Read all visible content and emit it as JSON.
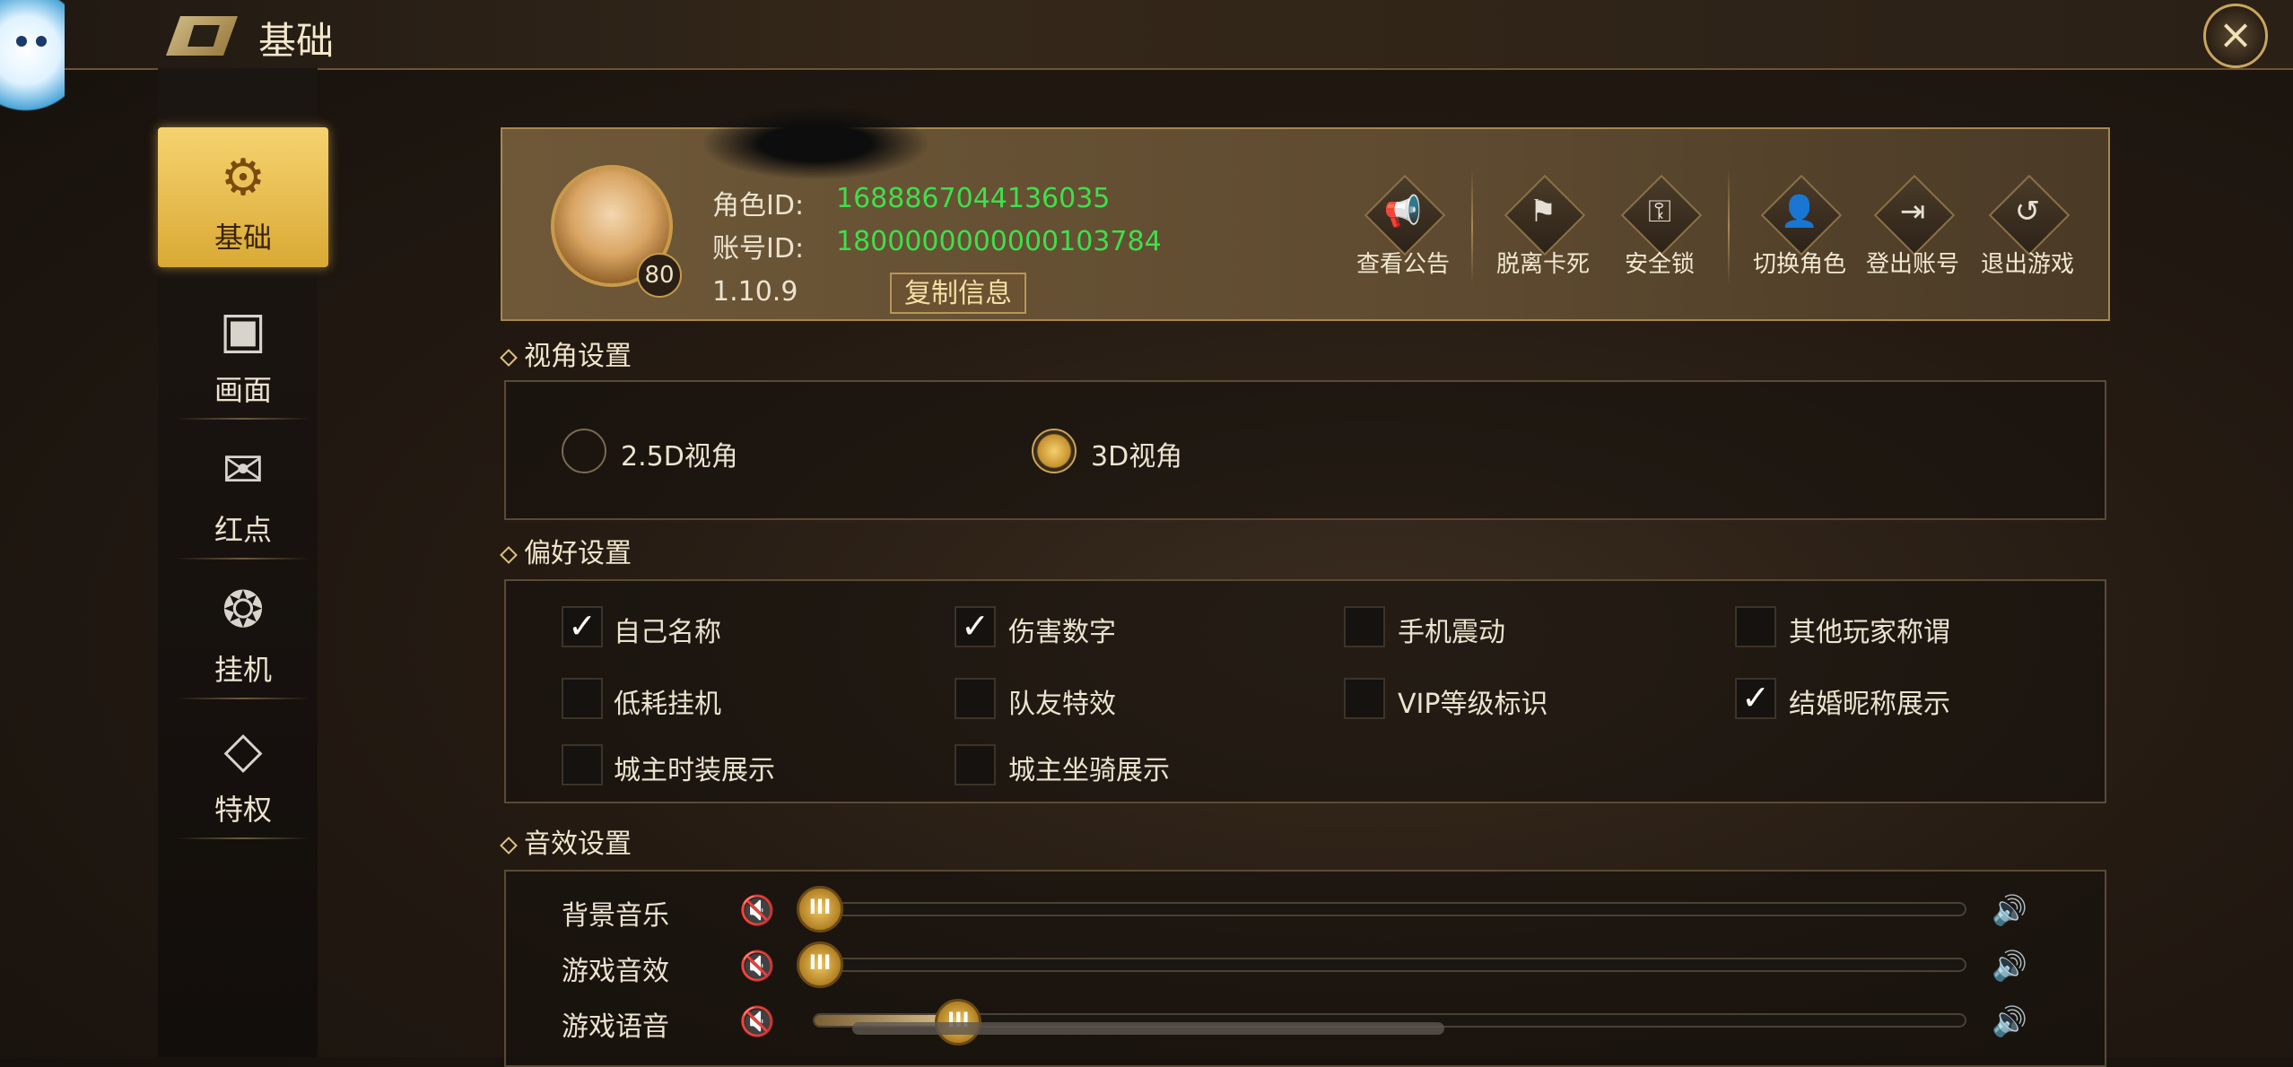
{
  "header": {
    "title": "基础",
    "close_icon": "close-icon"
  },
  "sidebar": {
    "items": [
      {
        "label": "基础",
        "icon": "gear-icon",
        "active": true
      },
      {
        "label": "画面",
        "icon": "image-icon",
        "active": false
      },
      {
        "label": "红点",
        "icon": "mail-alert-icon",
        "active": false
      },
      {
        "label": "挂机",
        "icon": "flame-icon",
        "active": false
      },
      {
        "label": "特权",
        "icon": "diamond-icon",
        "active": false
      }
    ]
  },
  "profile": {
    "level": "80",
    "role_id_label": "角色ID:",
    "role_id": "1688867044136035",
    "account_id_label": "账号ID:",
    "account_id": "1800000000000103784",
    "version": "1.10.9",
    "copy_label": "复制信息",
    "actions": [
      {
        "label": "查看公告",
        "icon": "announcement-icon"
      },
      {
        "label": "脱离卡死",
        "icon": "unstuck-icon"
      },
      {
        "label": "安全锁",
        "icon": "key-icon"
      },
      {
        "label": "切换角色",
        "icon": "switch-user-icon"
      },
      {
        "label": "登出账号",
        "icon": "logout-icon"
      },
      {
        "label": "退出游戏",
        "icon": "exit-game-icon"
      }
    ]
  },
  "view_settings": {
    "title": "视角设置",
    "options": [
      {
        "label": "2.5D视角",
        "selected": false
      },
      {
        "label": "3D视角",
        "selected": true
      }
    ]
  },
  "preference_settings": {
    "title": "偏好设置",
    "options": [
      {
        "label": "自己名称",
        "checked": true
      },
      {
        "label": "伤害数字",
        "checked": true
      },
      {
        "label": "手机震动",
        "checked": false
      },
      {
        "label": "其他玩家称谓",
        "checked": false
      },
      {
        "label": "低耗挂机",
        "checked": false
      },
      {
        "label": "队友特效",
        "checked": false
      },
      {
        "label": "VIP等级标识",
        "checked": false
      },
      {
        "label": "结婚昵称展示",
        "checked": true
      },
      {
        "label": "城主时装展示",
        "checked": false
      },
      {
        "label": "城主坐骑展示",
        "checked": false
      }
    ]
  },
  "sound_settings": {
    "title": "音效设置",
    "sliders": [
      {
        "label": "背景音乐",
        "value": 0.0
      },
      {
        "label": "游戏音效",
        "value": 0.0
      },
      {
        "label": "游戏语音",
        "value": 0.12
      }
    ],
    "mute_icon": "speaker-muted-icon",
    "max_icon": "speaker-icon"
  },
  "colors": {
    "accent": "#f2cd68",
    "id_green": "#3ee04a",
    "panel": "#5e4a30"
  }
}
